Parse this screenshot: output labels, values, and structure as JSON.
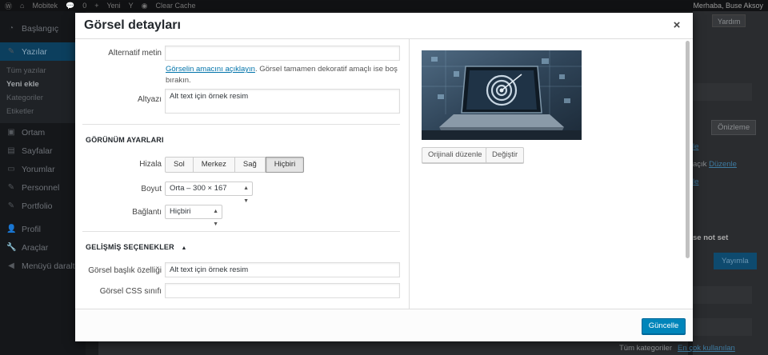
{
  "admin_bar": {
    "site_name": "Mobitek",
    "comments_count": "0",
    "new_label": "Yeni",
    "clear_cache": "Clear Cache",
    "greeting": "Merhaba, Buse Aksoy"
  },
  "wp_menu": {
    "items": [
      {
        "label": "Başlangıç"
      },
      {
        "label": "Yazılar"
      },
      {
        "label": "Ortam"
      },
      {
        "label": "Sayfalar"
      },
      {
        "label": "Yorumlar"
      },
      {
        "label": "Personnel"
      },
      {
        "label": "Portfolio"
      },
      {
        "label": "Profil"
      },
      {
        "label": "Araçlar"
      },
      {
        "label": "Menüyü daralt"
      }
    ],
    "sub_items": [
      {
        "label": "Tüm yazılar"
      },
      {
        "label": "Yeni ekle"
      },
      {
        "label": "Kategoriler"
      },
      {
        "label": "Etiketler"
      }
    ]
  },
  "background": {
    "help_tab": "Yardım",
    "preview_btn": "Önizleme",
    "link1": "le",
    "visibility": "açık",
    "edit_link": "Düzenle",
    "link2": "le",
    "not_set": "se not set",
    "publish_btn": "Yayımla",
    "all_categories": "Tüm kategoriler",
    "most_used": "En çok kullanılan"
  },
  "modal": {
    "title": "Görsel detayları",
    "close_symbol": "×",
    "fields": {
      "alt_label": "Alternatif metin",
      "alt_value": "",
      "alt_help_link": "Görselin amacını açıklayın",
      "alt_help_rest": ". Görsel tamamen dekoratif amaçlı ise boş bırakın.",
      "caption_label": "Altyazı",
      "caption_value": "Alt text için örnek resim"
    },
    "display_settings": {
      "title": "GÖRÜNÜM AYARLARI",
      "align_label": "Hizala",
      "align_options": [
        "Sol",
        "Merkez",
        "Sağ",
        "Hiçbiri"
      ],
      "align_selected": "Hiçbiri",
      "size_label": "Boyut",
      "size_value": "Orta – 300 × 167",
      "link_label": "Bağlantı",
      "link_value": "Hiçbiri"
    },
    "advanced": {
      "title": "GELİŞMİŞ SEÇENEKLER",
      "toggle_symbol": "▲",
      "title_attr_label": "Görsel başlık özelliği",
      "title_attr_value": "Alt text için örnek resim",
      "css_label": "Görsel CSS sınıfı",
      "css_value": ""
    },
    "image_actions": {
      "edit_original": "Orijinali düzenle",
      "replace": "Değiştir"
    },
    "footer": {
      "update_btn": "Güncelle"
    }
  }
}
